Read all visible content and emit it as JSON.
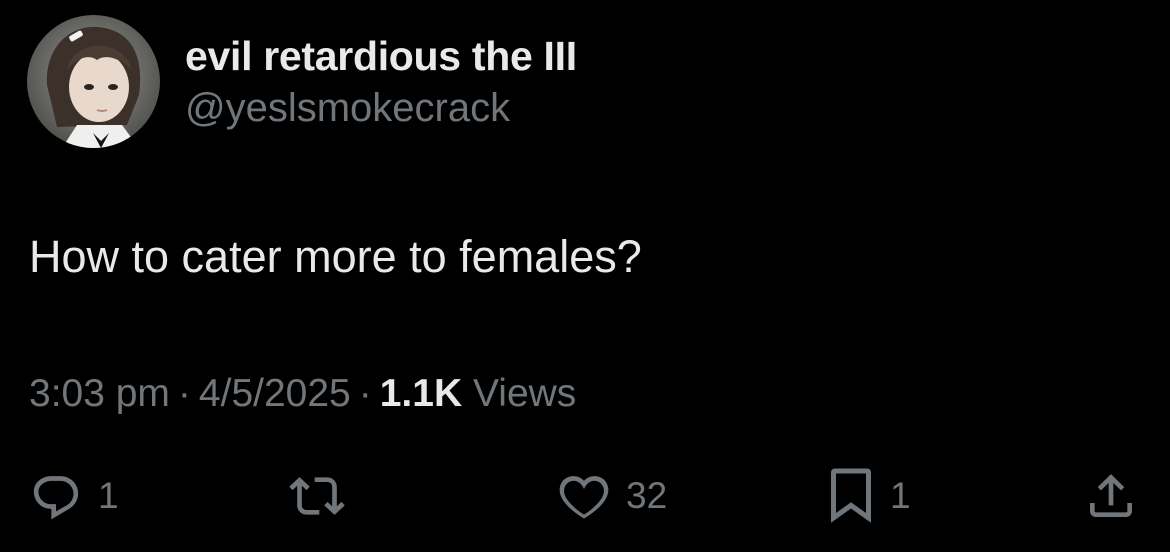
{
  "author": {
    "display_name": "evil retardious the III",
    "handle": "@yeslsmokecrack"
  },
  "tweet": {
    "text": "How to cater more to females?"
  },
  "meta": {
    "time": "3:03 pm",
    "separator": "·",
    "date": "4/5/2025",
    "views_count": "1.1K",
    "views_label": "Views"
  },
  "actions": {
    "reply_count": "1",
    "like_count": "32",
    "bookmark_count": "1"
  },
  "colors": {
    "background": "#000000",
    "primary_text": "#e7e9ea",
    "secondary_text": "#71767b"
  },
  "icons": [
    "reply-icon",
    "retweet-icon",
    "heart-icon",
    "bookmark-icon",
    "share-icon"
  ]
}
